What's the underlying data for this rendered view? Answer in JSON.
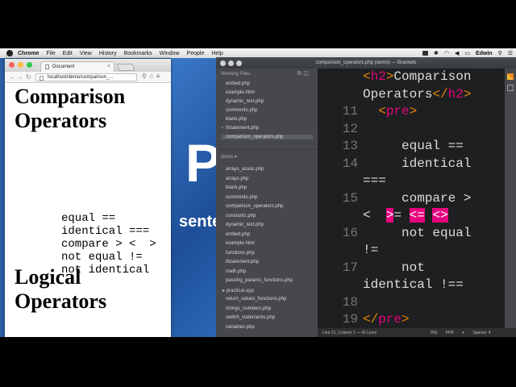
{
  "menubar": {
    "app": "Chrome",
    "items": [
      "File",
      "Edit",
      "View",
      "History",
      "Bookmarks",
      "Window",
      "People",
      "Help"
    ],
    "user": "Edwin"
  },
  "browser": {
    "tab_title": "Document",
    "url": "localhost/demo/comparison_...",
    "headings": [
      "Comparison",
      "Operators",
      "Logical",
      "Operators"
    ],
    "pre_lines": [
      "equal ==",
      "identical ===",
      "compare > <  >",
      "not equal !=",
      "not identical"
    ]
  },
  "desktop": {
    "big_letter": "P",
    "word": "sente"
  },
  "brackets": {
    "title": "comparison_operators.php (demo) — Brackets",
    "working_files_label": "Working Files",
    "working_files": [
      "embed.php",
      "example.html",
      "dynamic_text.php",
      "comments.php",
      "blank.php",
      "ifstatement.php",
      "comparison_operators.php"
    ],
    "project_label": "demo",
    "project_files": [
      "arrays_assoc.php",
      "arrays.php",
      "blank.php",
      "comments.php",
      "comparison_operators.php",
      "constants.php",
      "dynamic_text.php",
      "embed.php",
      "example.html",
      "functions.php",
      "ifstatement.php",
      "math.php",
      "passing_params_functions.php",
      "practical-app",
      "return_values_functions.php",
      "strings_numbers.php",
      "switch_statements.php",
      "variables.php"
    ],
    "gutter": [
      "",
      "",
      "11",
      "12",
      "13",
      "14",
      "",
      "15",
      "",
      "16",
      "",
      "17",
      "",
      "18",
      "19"
    ],
    "status_left": "Line 21, Column 1 — 41 Lines",
    "status_ins": "INS",
    "status_lang": "PHP",
    "status_spaces": "Spaces: 4"
  }
}
